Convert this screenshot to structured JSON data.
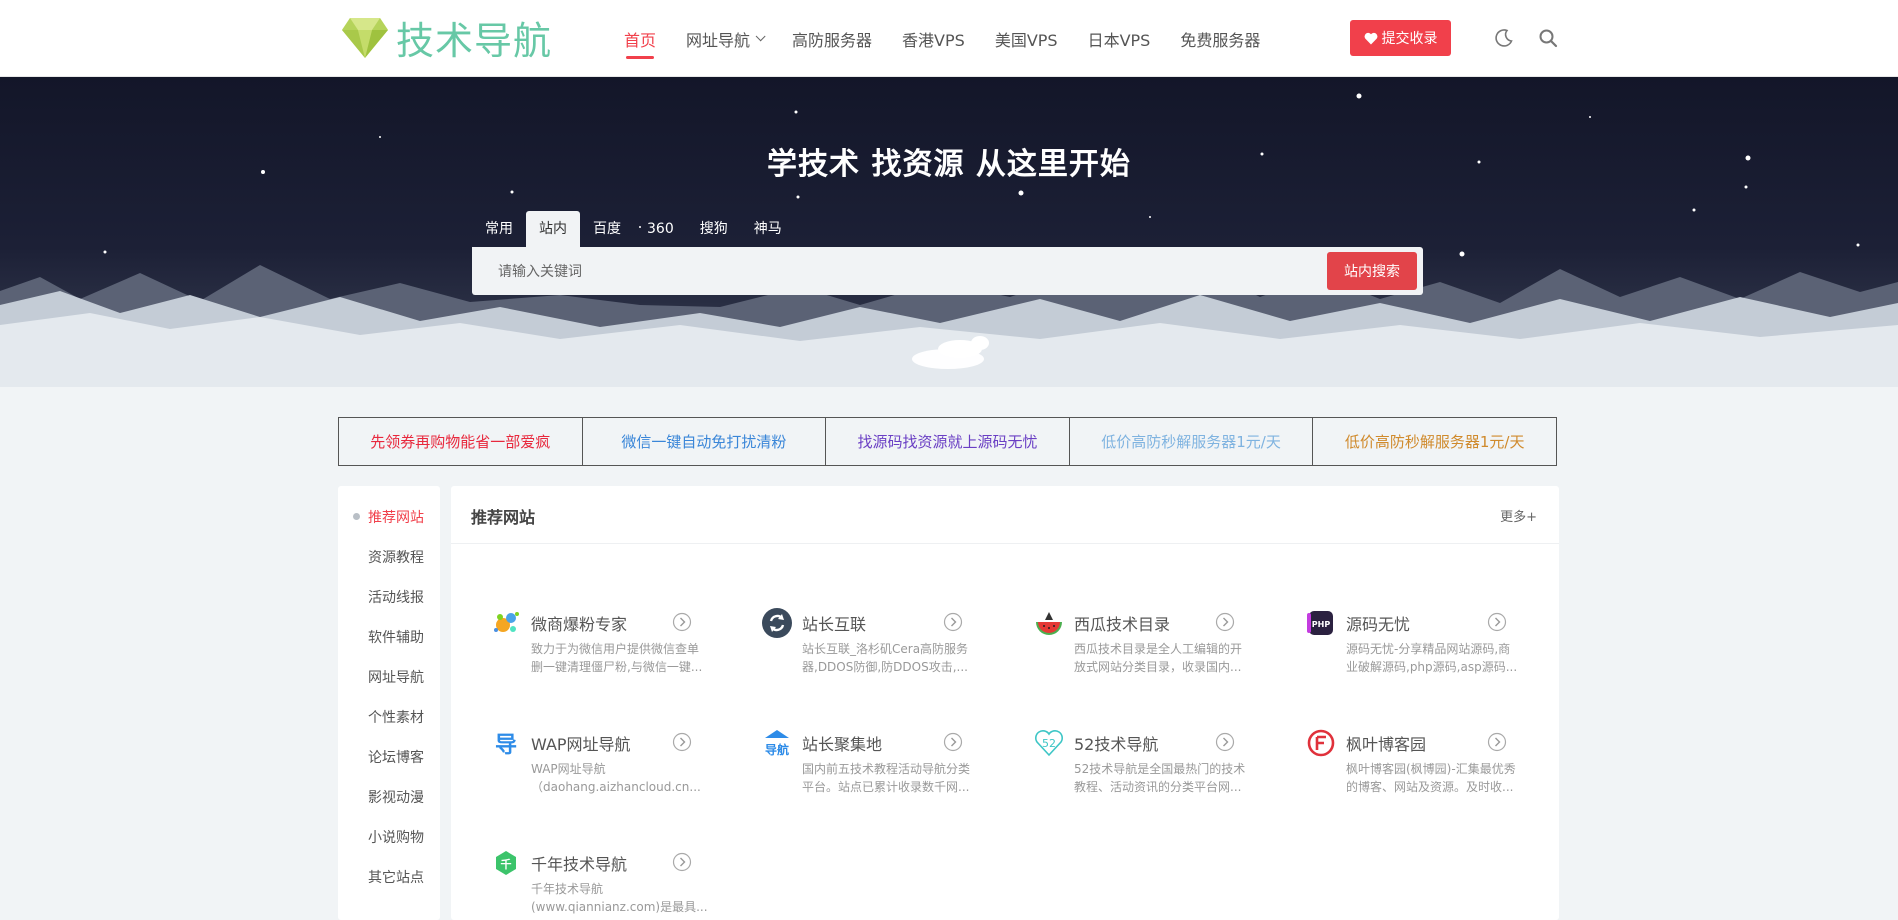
{
  "header": {
    "logo_text": "技术导航",
    "nav": [
      {
        "label": "首页",
        "active": true
      },
      {
        "label": "网址导航",
        "dropdown": true
      },
      {
        "label": "高防服务器"
      },
      {
        "label": "香港VPS"
      },
      {
        "label": "美国VPS"
      },
      {
        "label": "日本VPS"
      },
      {
        "label": "免费服务器"
      }
    ],
    "submit_label": "提交收录",
    "icons": [
      "heart-icon",
      "moon-icon",
      "search-icon"
    ]
  },
  "hero": {
    "title": "学技术 找资源 从这里开始",
    "tabs": [
      "常用",
      "站内",
      "百度",
      "360",
      "搜狗",
      "神马"
    ],
    "active_tab": "站内",
    "search_placeholder": "请输入关键词",
    "search_button": "站内搜索"
  },
  "ads": [
    {
      "label": "先领券再购物能省一部爱疯",
      "color": "#e8283d"
    },
    {
      "label": "微信一键自动免打扰清粉",
      "color": "#3a86d8"
    },
    {
      "label": "找源码找资源就上源码无忧",
      "color": "#6a3fc4"
    },
    {
      "label": "低价高防秒解服务器1元/天",
      "color": "#7fb3e0"
    },
    {
      "label": "低价高防秒解服务器1元/天",
      "color": "#d08a2c"
    }
  ],
  "sidebar": {
    "items": [
      "推荐网站",
      "资源教程",
      "活动线报",
      "软件辅助",
      "网址导航",
      "个性素材",
      "论坛博客",
      "影视动漫",
      "小说购物",
      "其它站点"
    ],
    "active_index": 0
  },
  "main": {
    "title": "推荐网站",
    "more": "更多+",
    "sites": [
      {
        "name": "微商爆粉专家",
        "desc": [
          "致力于为微信用户提供微信查单",
          "删一键清理僵尸粉,与微信一键..."
        ],
        "icon": "splash-logo-icon"
      },
      {
        "name": "站长互联",
        "desc": [
          "站长互联_洛杉矶Cera高防服务",
          "器,DDOS防御,防DDOS攻击,..."
        ],
        "icon": "refresh-logo-icon"
      },
      {
        "name": "西瓜技术目录",
        "desc": [
          "西瓜技术目录是全人工编辑的开",
          "放式网站分类目录，收录国内..."
        ],
        "icon": "watermelon-logo-icon"
      },
      {
        "name": "源码无忧",
        "desc": [
          "源码无忧-分享精品网站源码,商",
          "业破解源码,php源码,asp源码..."
        ],
        "icon": "php-logo-icon"
      },
      {
        "name": "WAP网址导航",
        "desc": [
          "WAP网址导航",
          "（daohang.aizhancloud.cn..."
        ],
        "icon": "wap-logo-icon"
      },
      {
        "name": "站长聚集地",
        "desc": [
          "国内前五技术教程活动导航分类",
          "平台。站点已累计收录数千网..."
        ],
        "icon": "daohang-logo-icon"
      },
      {
        "name": "52技术导航",
        "desc": [
          "52技术导航是全国最热门的技术",
          "教程、活动资讯的分类平台网..."
        ],
        "icon": "heart52-logo-icon"
      },
      {
        "name": "枫叶博客园",
        "desc": [
          "枫叶博客园(枫博园)-汇集最优秀",
          "的博客、网站及资源。及时收..."
        ],
        "icon": "maple-logo-icon"
      },
      {
        "name": "千年技术导航",
        "desc": [
          "千年技术导航",
          "(www.qiannianz.com)是最具..."
        ],
        "icon": "hexagon-logo-icon"
      }
    ]
  }
}
